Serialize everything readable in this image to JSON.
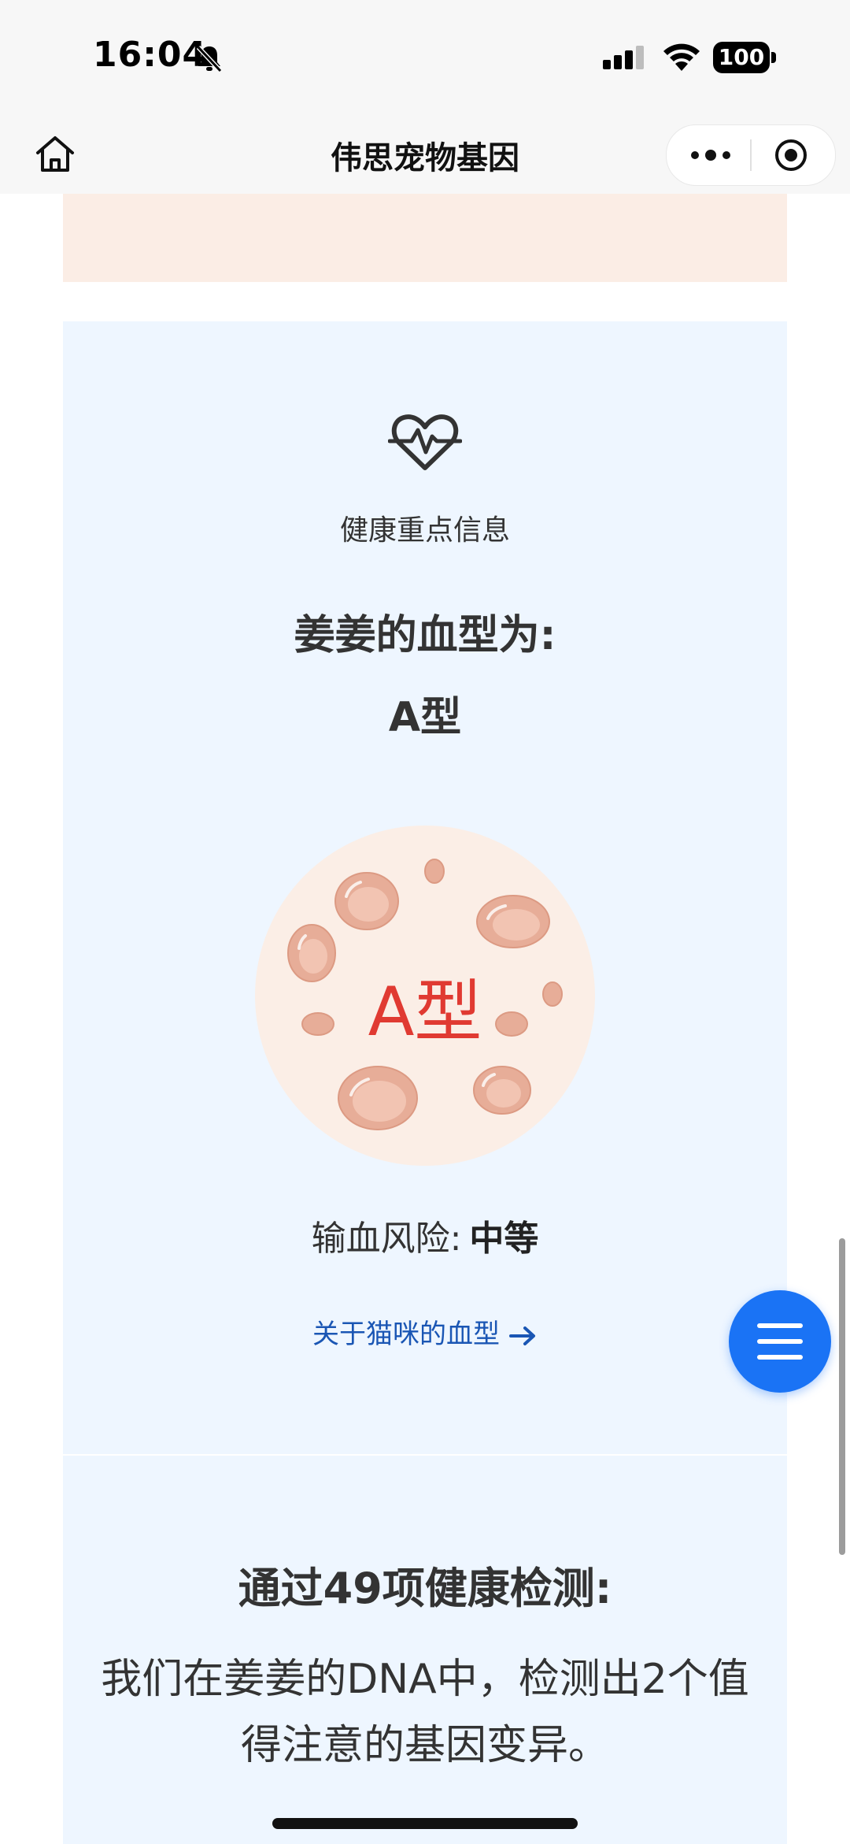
{
  "status_bar": {
    "time": "16:04",
    "battery": "100",
    "icons": [
      "bell-muted-icon",
      "cellular-signal-icon",
      "wifi-icon",
      "battery-icon"
    ]
  },
  "nav": {
    "title": "伟思宠物基因",
    "icons": [
      "home-icon",
      "more-icon",
      "close-miniprogram-icon"
    ]
  },
  "health": {
    "section_label": "健康重点信息",
    "heading": "姜姜的血型为:",
    "blood_type": "A型",
    "badge_text": "A型",
    "risk_label": "输血风险:",
    "risk_value": "中等",
    "link_text": "关于猫咪的血型"
  },
  "summary": {
    "title": "通过49项健康检测:",
    "text": "我们在姜姜的DNA中，检测出2个值得注意的基因变异。"
  },
  "colors": {
    "accent_blue": "#1a73f5",
    "link_blue": "#1a56b4",
    "card_blue": "#eef6ff",
    "card_peach": "#fbede5",
    "blood_red": "#e03a32"
  }
}
